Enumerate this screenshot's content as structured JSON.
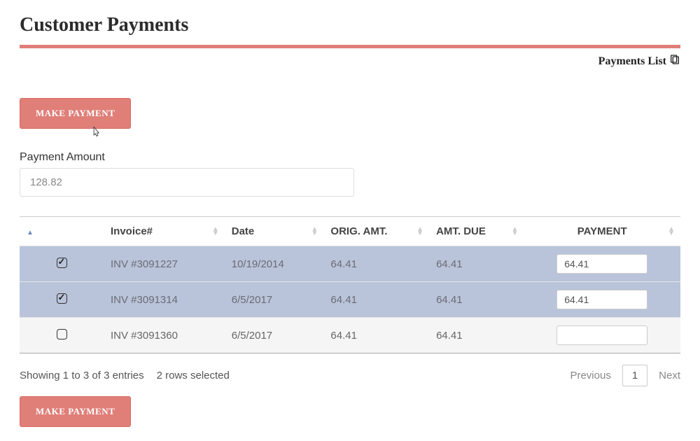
{
  "header": {
    "title": "Customer Payments",
    "payments_list_label": "Payments List"
  },
  "actions": {
    "make_payment_label": "MAKE PAYMENT"
  },
  "payment_amount": {
    "label": "Payment Amount",
    "value": "128.82"
  },
  "table": {
    "columns": {
      "invoice": "Invoice#",
      "date": "Date",
      "orig_amt": "ORIG. AMT.",
      "amt_due": "AMT. DUE",
      "payment": "PAYMENT"
    },
    "rows": [
      {
        "selected": true,
        "invoice": "INV #3091227",
        "date": "10/19/2014",
        "orig_amt": "64.41",
        "amt_due": "64.41",
        "payment": "64.41"
      },
      {
        "selected": true,
        "invoice": "INV #3091314",
        "date": "6/5/2017",
        "orig_amt": "64.41",
        "amt_due": "64.41",
        "payment": "64.41"
      },
      {
        "selected": false,
        "invoice": "INV #3091360",
        "date": "6/5/2017",
        "orig_amt": "64.41",
        "amt_due": "64.41",
        "payment": ""
      }
    ]
  },
  "footer": {
    "showing": "Showing 1 to 3 of 3 entries",
    "selected_text": "2 rows selected",
    "previous": "Previous",
    "page": "1",
    "next": "Next"
  }
}
